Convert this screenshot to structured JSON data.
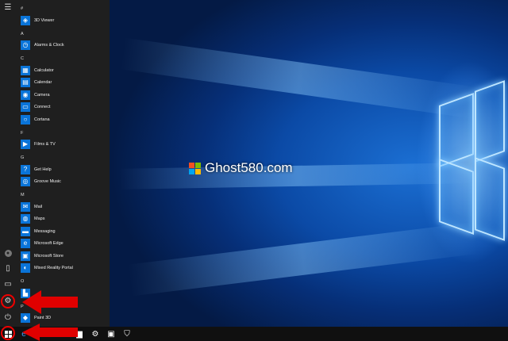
{
  "watermark": {
    "text": "Ghost580.com"
  },
  "rail": {
    "hamburger_icon": "hamburger-icon",
    "user_icon": "user-icon",
    "document_icon": "document-icon",
    "pictures_icon": "pictures-icon",
    "settings_icon": "gear-icon",
    "power_icon": "power-icon"
  },
  "apps": {
    "groups": [
      {
        "letter": "#",
        "items": [
          {
            "label": "3D Viewer",
            "icon": "cube-icon",
            "glyph": "◈"
          }
        ]
      },
      {
        "letter": "A",
        "items": [
          {
            "label": "Alarms & Clock",
            "icon": "clock-icon",
            "glyph": "◷"
          }
        ]
      },
      {
        "letter": "C",
        "items": [
          {
            "label": "Calculator",
            "icon": "calculator-icon",
            "glyph": "▦"
          },
          {
            "label": "Calendar",
            "icon": "calendar-icon",
            "glyph": "▤"
          },
          {
            "label": "Camera",
            "icon": "camera-icon",
            "glyph": "◉"
          },
          {
            "label": "Connect",
            "icon": "connect-icon",
            "glyph": "▭"
          },
          {
            "label": "Cortana",
            "icon": "cortana-icon",
            "glyph": "○"
          }
        ]
      },
      {
        "letter": "F",
        "items": [
          {
            "label": "Films & TV",
            "icon": "film-icon",
            "glyph": "▶"
          }
        ]
      },
      {
        "letter": "G",
        "items": [
          {
            "label": "Get Help",
            "icon": "help-icon",
            "glyph": "?"
          },
          {
            "label": "Groove Music",
            "icon": "music-icon",
            "glyph": "◎"
          }
        ]
      },
      {
        "letter": "M",
        "items": [
          {
            "label": "Mail",
            "icon": "mail-icon",
            "glyph": "✉"
          },
          {
            "label": "Maps",
            "icon": "map-icon",
            "glyph": "◍"
          },
          {
            "label": "Messaging",
            "icon": "message-icon",
            "glyph": "▬"
          },
          {
            "label": "Microsoft Edge",
            "icon": "edge-icon",
            "glyph": "e"
          },
          {
            "label": "Microsoft Store",
            "icon": "store-icon",
            "glyph": "▣"
          },
          {
            "label": "Mixed Reality Portal",
            "icon": "mixed-reality-icon",
            "glyph": "◐"
          }
        ]
      },
      {
        "letter": "O",
        "items": [
          {
            "label": "",
            "icon": "office-icon",
            "glyph": "▙"
          }
        ]
      },
      {
        "letter": "P",
        "items": [
          {
            "label": "Paint 3D",
            "icon": "paint3d-icon",
            "glyph": "◆"
          }
        ]
      }
    ]
  },
  "taskbar": {
    "items": [
      {
        "name": "start-button",
        "glyph": "",
        "icon": "windows-logo-icon"
      },
      {
        "name": "edge-taskbar-button",
        "glyph": "e",
        "icon": "edge-icon"
      },
      {
        "name": "gap",
        "glyph": "",
        "icon": ""
      },
      {
        "name": "file-explorer-taskbar-button",
        "glyph": "▆",
        "icon": "folder-icon"
      },
      {
        "name": "settings-taskbar-button",
        "glyph": "⚙",
        "icon": "gear-icon"
      },
      {
        "name": "store-taskbar-button",
        "glyph": "▣",
        "icon": "store-icon"
      },
      {
        "name": "security-taskbar-button",
        "glyph": "⛉",
        "icon": "shield-icon"
      }
    ]
  },
  "colors": {
    "accent": "#0a74d8",
    "arrow": "#e00000"
  }
}
